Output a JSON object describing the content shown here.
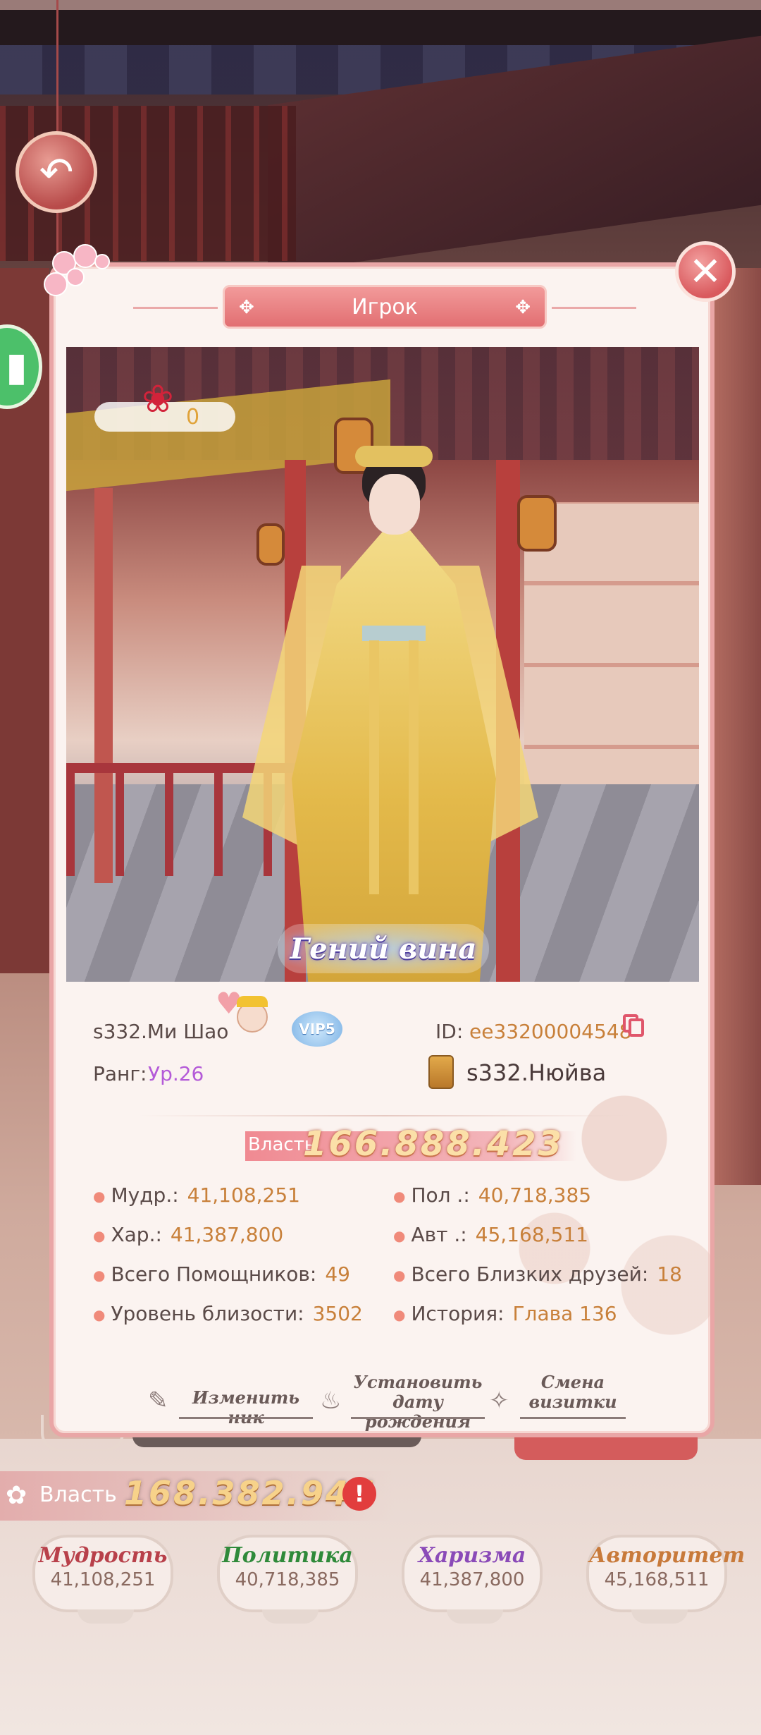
{
  "dialog": {
    "title": "Игрок",
    "close_icon": "close-icon",
    "rose_count": "0",
    "portrait_title": "Гений вина",
    "player": {
      "name": "s332.Ми Шао",
      "vip": "VIP5",
      "id_label": "ID:",
      "id_value": "ee33200004548",
      "rank_label": "Ранг:",
      "rank_value": "Ур.26",
      "alliance": "s332.Нюйва"
    },
    "power": {
      "label": "Власть",
      "value": "166.888.423"
    },
    "stats": [
      {
        "label": "Мудр.:",
        "value": "41,108,251"
      },
      {
        "label": "Пол .:",
        "value": "40,718,385"
      },
      {
        "label": "Хар.:",
        "value": "41,387,800"
      },
      {
        "label": "Авт .:",
        "value": "45,168,511"
      },
      {
        "label": "Всего Помощников:",
        "value": "49"
      },
      {
        "label": "Всего Близких друзей:",
        "value": "18"
      },
      {
        "label": "Уровень близости:",
        "value": "3502"
      },
      {
        "label": "История:",
        "value": "Глава 136"
      }
    ],
    "actions": {
      "rename": "Изменить ник",
      "birthday_line1": "Установить",
      "birthday_line2": "дату рождения",
      "card_line1": "Смена",
      "card_line2": "визитки"
    }
  },
  "background": {
    "power_label": "Власть",
    "power_value": "168.382.947",
    "stat_cards": [
      {
        "title": "Мудрость",
        "value": "41,108,251",
        "color": "#b8404a"
      },
      {
        "title": "Политика",
        "value": "40,718,385",
        "color": "#2f8a3a"
      },
      {
        "title": "Харизма",
        "value": "41,387,800",
        "color": "#8a4ab8"
      },
      {
        "title": "Авторитет",
        "value": "45,168,511",
        "color": "#c87a3a"
      }
    ]
  },
  "colors": {
    "accent": "#e26f72",
    "value_gold": "#c8803a",
    "rank_purple": "#b45ad8"
  }
}
